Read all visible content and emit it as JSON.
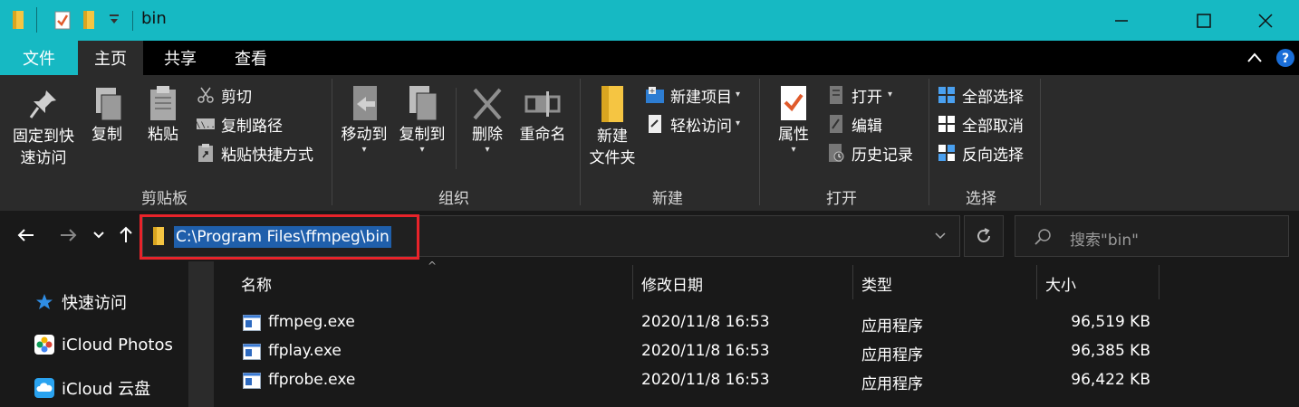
{
  "window": {
    "title": "bin",
    "colors": {
      "accent": "#16b9c3",
      "ribbon": "#2b2b2b",
      "background": "#191919",
      "highlight": "#e8232a",
      "selection": "#1f5fab"
    }
  },
  "ribbon_tabs": [
    "文件",
    "主页",
    "共享",
    "查看"
  ],
  "ribbon": {
    "clipboard": {
      "pin_line1": "固定到快",
      "pin_line2": "速访问",
      "copy": "复制",
      "paste": "粘贴",
      "cut": "剪切",
      "copy_path": "复制路径",
      "paste_shortcut": "粘贴快捷方式",
      "group_label": "剪贴板"
    },
    "organize": {
      "move_to": "移动到",
      "copy_to": "复制到",
      "delete": "删除",
      "rename": "重命名",
      "group_label": "组织"
    },
    "new": {
      "folder_line1": "新建",
      "folder_line2": "文件夹",
      "new_item": "新建项目",
      "easy_access": "轻松访问",
      "group_label": "新建"
    },
    "open": {
      "properties": "属性",
      "open": "打开",
      "edit": "编辑",
      "history": "历史记录",
      "group_label": "打开"
    },
    "select": {
      "select_all": "全部选择",
      "select_none": "全部取消",
      "invert": "反向选择",
      "group_label": "选择"
    }
  },
  "address": {
    "path": "C:\\Program Files\\ffmpeg\\bin",
    "search_placeholder": "搜索\"bin\""
  },
  "nav_pane": {
    "items": [
      "快速访问",
      "iCloud Photos",
      "iCloud 云盘"
    ]
  },
  "file_list": {
    "columns": [
      "名称",
      "修改日期",
      "类型",
      "大小"
    ],
    "rows": [
      {
        "name": "ffmpeg.exe",
        "date": "2020/11/8 16:53",
        "type": "应用程序",
        "size": "96,519 KB"
      },
      {
        "name": "ffplay.exe",
        "date": "2020/11/8 16:53",
        "type": "应用程序",
        "size": "96,385 KB"
      },
      {
        "name": "ffprobe.exe",
        "date": "2020/11/8 16:53",
        "type": "应用程序",
        "size": "96,422 KB"
      }
    ]
  }
}
